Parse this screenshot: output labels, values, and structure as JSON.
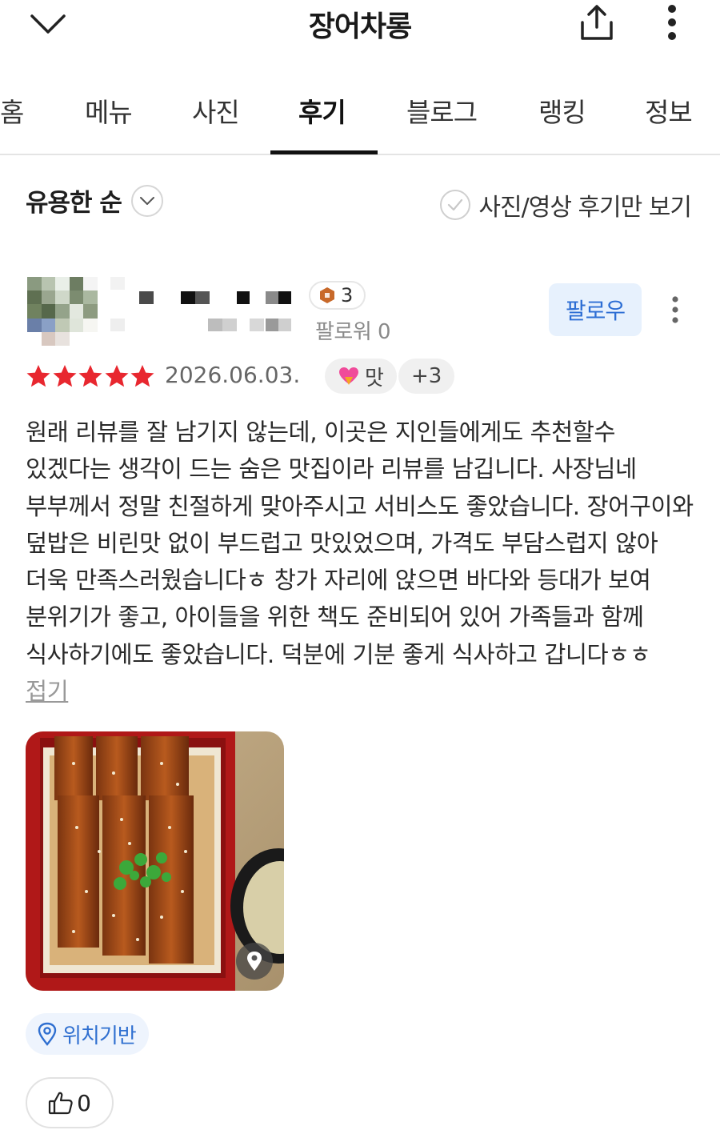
{
  "header": {
    "title": "장어차롱",
    "back_icon": "chevron-down-icon",
    "share_icon": "share-icon",
    "more_icon": "more-vertical-icon"
  },
  "tabs": [
    {
      "label": "홈",
      "active": false
    },
    {
      "label": "메뉴",
      "active": false
    },
    {
      "label": "사진",
      "active": false
    },
    {
      "label": "후기",
      "active": true
    },
    {
      "label": "블로그",
      "active": false
    },
    {
      "label": "랭킹",
      "active": false
    },
    {
      "label": "정보",
      "active": false
    }
  ],
  "filters": {
    "sort_label": "유용한 순",
    "photo_only_label": "사진/영상 후기만 보기",
    "photo_only_checked": false
  },
  "review": {
    "reviewer_level": "3",
    "followers_label": "팔로워 0",
    "follow_label": "팔로우",
    "rating": 5,
    "date": "2026.06.03.",
    "tag_taste": "맛",
    "tag_more": "+3",
    "text": "원래 리뷰를 잘 남기지 않는데, 이곳은 지인들에게도 추천할수 있겠다는 생각이 드는 숨은 맛집이라 리뷰를 남깁니다. 사장님네 부부께서 정말 친절하게 맞아주시고 서비스도 좋았습니다. 장어구이와 덮밥은 비린맛 없이 부드럽고 맛있었으며, 가격도 부담스럽지 않아 더욱 만족스러웠습니다ㅎ 창가 자리에 앉으면 바다와 등대가 보여 분위기가 좋고, 아이들을 위한 책도 준비되어 있어 가족들과 함께 식사하기에도 좋았습니다. 덕분에 기분 좋게 식사하고 갑니다ㅎㅎ",
    "fold_label": "접기",
    "location_label": "위치기반",
    "like_count": "0"
  },
  "colors": {
    "star": "#e8272f",
    "accent_blue": "#2d6ed4",
    "follow_bg": "#e7f1fd",
    "level_badge": "#c8692a"
  }
}
